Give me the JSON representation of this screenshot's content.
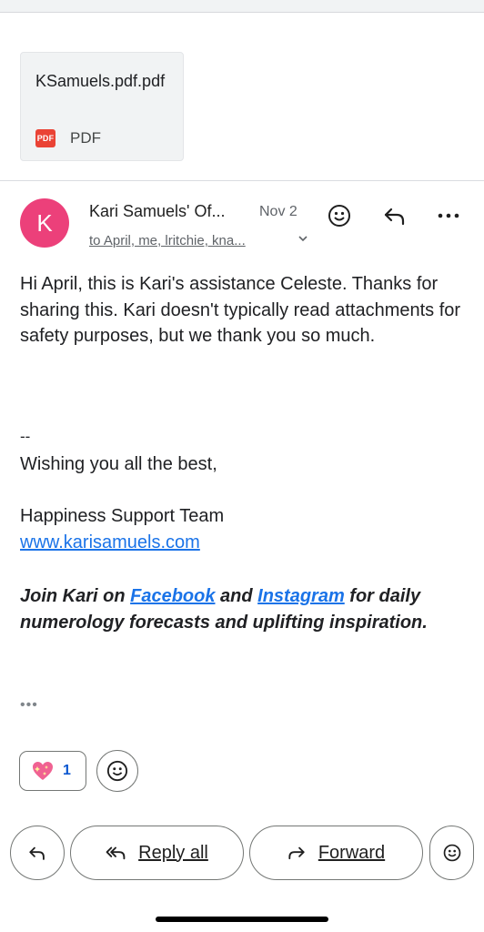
{
  "attachment": {
    "filename": "KSamuels.pdf.pdf",
    "type_label": "PDF",
    "icon_text": "PDF",
    "icon": "pdf-file-icon"
  },
  "message": {
    "avatar_letter": "K",
    "avatar_color": "#ec407a",
    "sender": "Kari Samuels' Of...",
    "date": "Nov 2",
    "recipients": "to April, me, lritchie, kna...",
    "body": "Hi April, this is Kari's assistance Celeste. Thanks for sharing this. Kari doesn't typically read attachments for safety purposes, but we thank you so much.",
    "signature": {
      "dash": "--",
      "wish": "Wishing you all the best,",
      "team": "Happiness Support Team",
      "url": "www.karisamuels.com"
    },
    "promo": {
      "pre": "Join Kari on ",
      "facebook": "Facebook",
      "mid": " and ",
      "instagram": "Instagram",
      "post": " for daily numerology forecasts and uplifting inspiration."
    },
    "trimmed": "•••"
  },
  "reactions": {
    "count": "1",
    "emoji": "sparkling-heart-icon"
  },
  "actions": {
    "reply_all": "Reply all",
    "forward": "Forward"
  },
  "colors": {
    "link": "#1a73e8",
    "reaction_count": "#0b57d0"
  }
}
